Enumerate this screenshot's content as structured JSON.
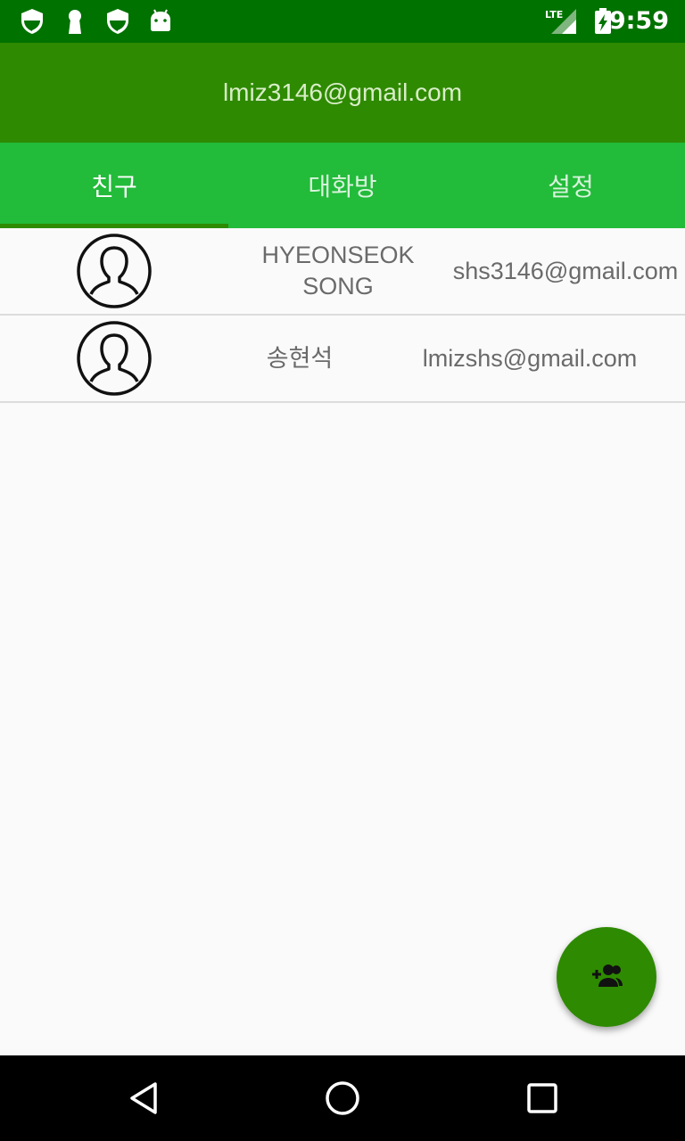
{
  "status_bar": {
    "time": "9:59",
    "network": "LTE",
    "icons": [
      "shield-icon",
      "keyhole-icon",
      "shield-icon",
      "android-icon",
      "signal-icon",
      "battery-charging-icon"
    ]
  },
  "app_bar": {
    "title": "lmiz3146@gmail.com"
  },
  "tabs": [
    {
      "label": "친구",
      "selected": true
    },
    {
      "label": "대화방",
      "selected": false
    },
    {
      "label": "설정",
      "selected": false
    }
  ],
  "friends": [
    {
      "name": "HYEONSEOK SONG",
      "email": "shs3146@gmail.com",
      "avatar_icon": "user-avatar-icon"
    },
    {
      "name": "송현석",
      "email": "lmizshs@gmail.com",
      "avatar_icon": "user-avatar-icon"
    }
  ],
  "fab": {
    "icon": "add-friend-icon"
  },
  "nav_bar": {
    "buttons": [
      "back-icon",
      "home-icon",
      "recents-icon"
    ]
  },
  "colors": {
    "status_bar": "#007200",
    "app_bar": "#2e8a00",
    "tab_bar": "#22bb3a",
    "tab_indicator": "#2e8a00",
    "fab": "#2e8a00"
  }
}
